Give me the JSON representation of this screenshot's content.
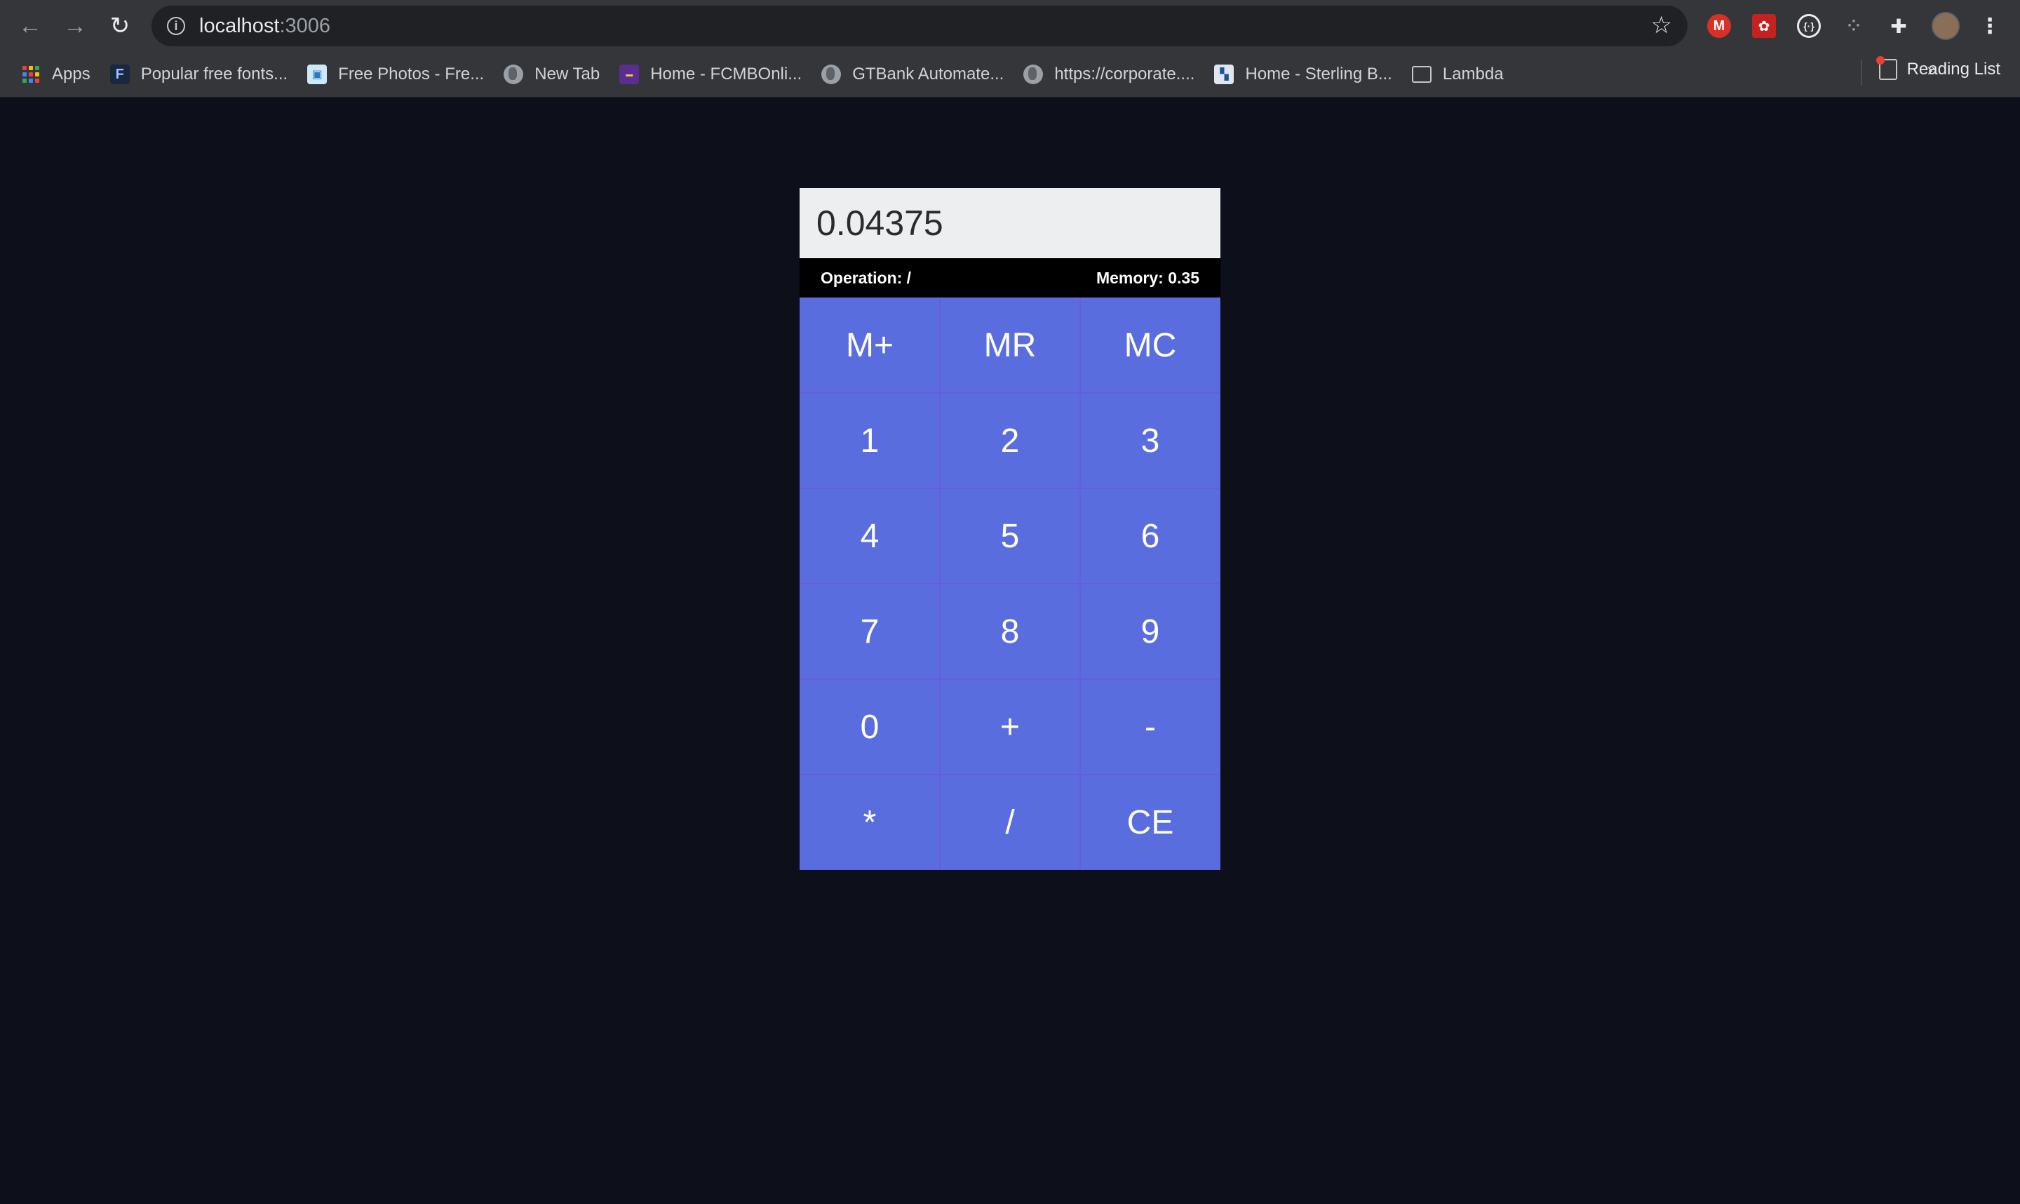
{
  "browser": {
    "url_host": "localhost",
    "url_port": ":3006",
    "bookmarks": [
      {
        "label": "Apps",
        "icon": "apps-grid-icon"
      },
      {
        "label": "Popular free fonts...",
        "icon": "fontsquirrel-icon"
      },
      {
        "label": "Free Photos - Fre...",
        "icon": "photos-icon"
      },
      {
        "label": "New Tab",
        "icon": "globe-icon"
      },
      {
        "label": "Home - FCMBOnli...",
        "icon": "fcmb-icon"
      },
      {
        "label": "GTBank Automate...",
        "icon": "globe-icon"
      },
      {
        "label": "https://corporate....",
        "icon": "globe-icon"
      },
      {
        "label": "Home - Sterling B...",
        "icon": "sterling-icon"
      },
      {
        "label": "Lambda",
        "icon": "folder-icon"
      }
    ],
    "overflow": "»",
    "reading_list": "Reading List"
  },
  "calculator": {
    "display_value": "0.04375",
    "operation_text": "Operation: /",
    "memory_text": "Memory: 0.35",
    "keys": [
      "M+",
      "MR",
      "MC",
      "1",
      "2",
      "3",
      "4",
      "5",
      "6",
      "7",
      "8",
      "9",
      "0",
      "+",
      "-",
      "*",
      "/",
      "CE"
    ]
  },
  "colors": {
    "page_background": "#0d0f1a",
    "key_background": "#5a6ddf",
    "display_background": "#eceef0"
  }
}
